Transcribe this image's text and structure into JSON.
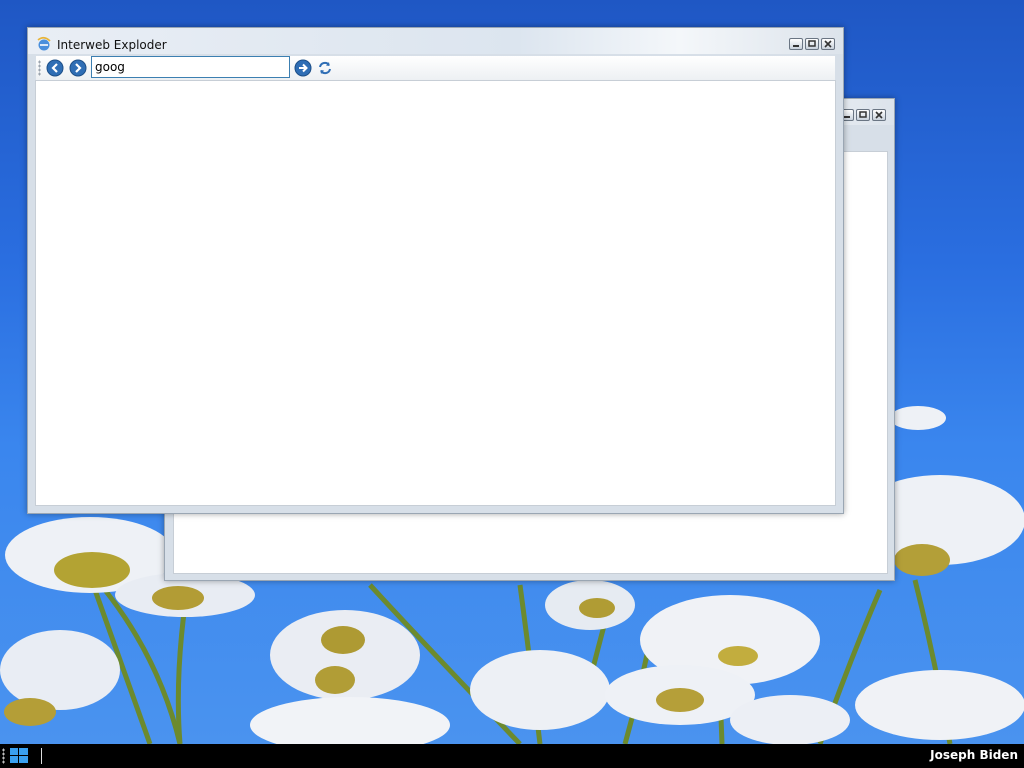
{
  "desktop": {
    "wallpaper": "blue sky with white daisies",
    "sky_color": "#2a6ee0"
  },
  "back_window": {
    "title": "",
    "buttons": [
      "minimize",
      "maximize",
      "close"
    ]
  },
  "browser": {
    "title": "Interweb Exploder",
    "app_icon": "browser-logo-icon",
    "toolbar": {
      "back_icon": "back-arrow-icon",
      "forward_icon": "forward-arrow-icon",
      "address_value": "goog",
      "go_icon": "go-arrow-icon",
      "refresh_icon": "refresh-icon"
    },
    "window_buttons": [
      "minimize",
      "maximize",
      "close"
    ]
  },
  "taskbar": {
    "start_icon": "windows-logo-icon",
    "user_name": "Joseph Biden"
  }
}
